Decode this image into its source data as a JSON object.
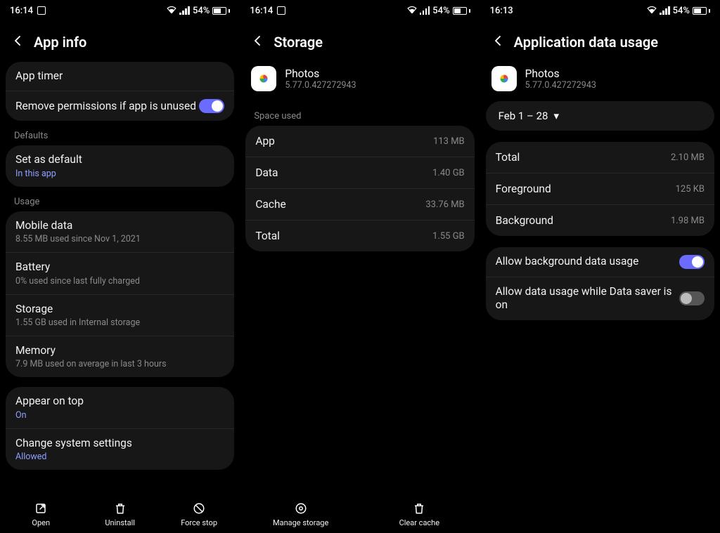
{
  "status": {
    "time_a": "16:14",
    "time_b": "16:14",
    "time_c": "16:13",
    "battery": "54%"
  },
  "colors": {
    "accent": "#8fa0ff",
    "toggle_on": "#6b6bff"
  },
  "pane1": {
    "title": "App info",
    "app_timer": "App timer",
    "remove_perm": "Remove permissions if app is unused",
    "defaults_label": "Defaults",
    "set_default": {
      "title": "Set as default",
      "sub": "In this app"
    },
    "usage_label": "Usage",
    "mobile_data": {
      "title": "Mobile data",
      "sub": "8.55 MB used since Nov 1, 2021"
    },
    "battery": {
      "title": "Battery",
      "sub": "0% used since last fully charged"
    },
    "storage": {
      "title": "Storage",
      "sub": "1.55 GB used in Internal storage"
    },
    "memory": {
      "title": "Memory",
      "sub": "7.9 MB used on average in last 3 hours"
    },
    "appear_on_top": {
      "title": "Appear on top",
      "sub": "On"
    },
    "change_sys": {
      "title": "Change system settings",
      "sub": "Allowed"
    },
    "bottom": {
      "open": "Open",
      "uninstall": "Uninstall",
      "force_stop": "Force stop"
    }
  },
  "pane2": {
    "title": "Storage",
    "app": {
      "name": "Photos",
      "ver": "5.77.0.427272943"
    },
    "space_used": "Space used",
    "rows": {
      "app": {
        "k": "App",
        "v": "113 MB"
      },
      "data": {
        "k": "Data",
        "v": "1.40 GB"
      },
      "cache": {
        "k": "Cache",
        "v": "33.76 MB"
      },
      "total": {
        "k": "Total",
        "v": "1.55 GB"
      }
    },
    "bottom": {
      "manage": "Manage storage",
      "clear": "Clear cache"
    }
  },
  "pane3": {
    "title": "Application data usage",
    "app": {
      "name": "Photos",
      "ver": "5.77.0.427272943"
    },
    "date_range": "Feb 1 – 28",
    "rows": {
      "total": {
        "k": "Total",
        "v": "2.10 MB"
      },
      "foreground": {
        "k": "Foreground",
        "v": "125 KB"
      },
      "background": {
        "k": "Background",
        "v": "1.98 MB"
      }
    },
    "allow_bg": "Allow background data usage",
    "allow_ds": "Allow data usage while Data saver is on"
  }
}
